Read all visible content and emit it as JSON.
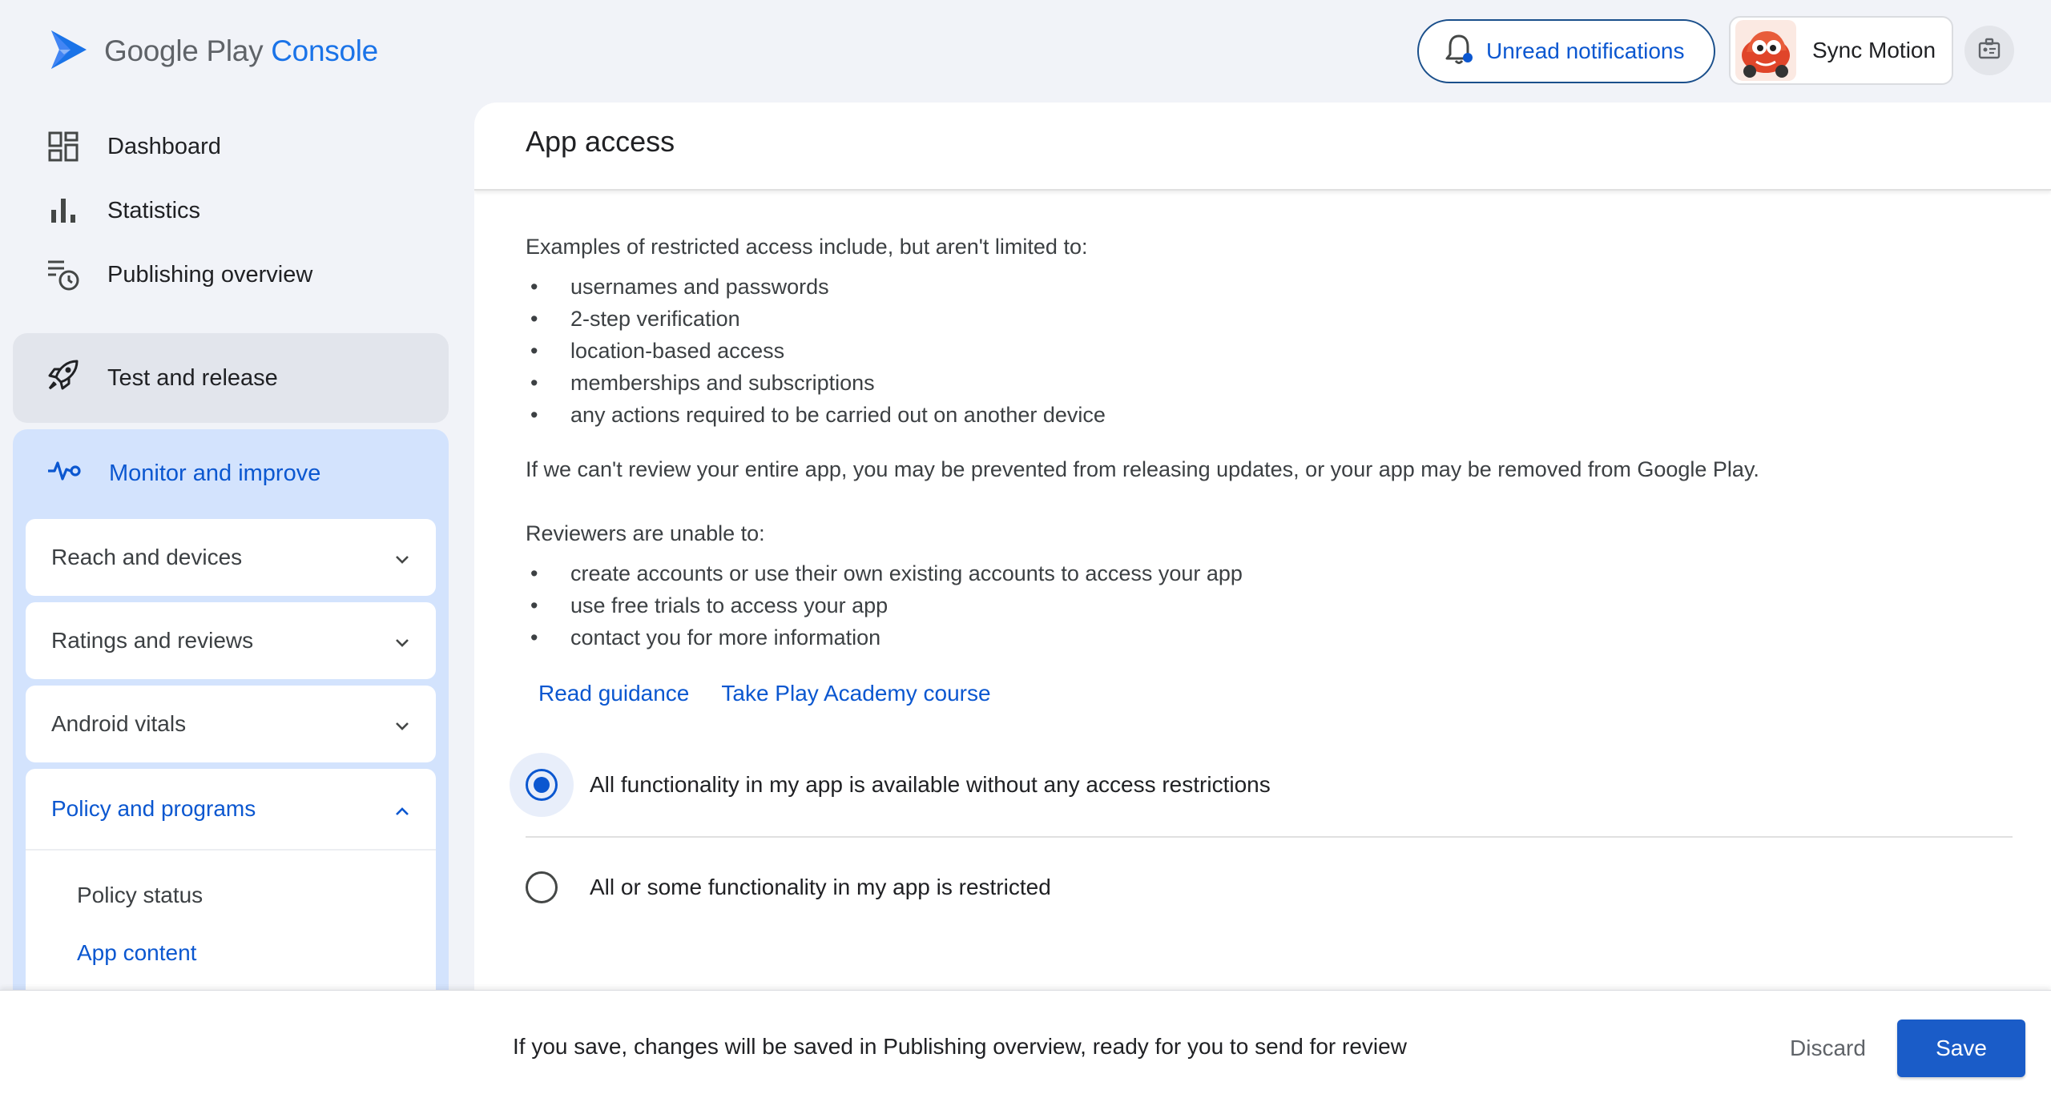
{
  "header": {
    "logo_google_play": "Google Play",
    "logo_console": "Console",
    "notifications_label": "Unread notifications",
    "account_name": "Sync Motion"
  },
  "sidebar": {
    "top_items": [
      {
        "label": "Dashboard",
        "icon": "dashboard-icon"
      },
      {
        "label": "Statistics",
        "icon": "bar-chart-icon"
      },
      {
        "label": "Publishing overview",
        "icon": "publishing-icon"
      }
    ],
    "test_release": {
      "label": "Test and release",
      "icon": "rocket-icon"
    },
    "monitor": {
      "label": "Monitor and improve",
      "icon": "pulse-icon",
      "sections": [
        {
          "label": "Reach and devices",
          "expanded": false
        },
        {
          "label": "Ratings and reviews",
          "expanded": false
        },
        {
          "label": "Android vitals",
          "expanded": false
        },
        {
          "label": "Policy and programs",
          "expanded": true
        }
      ],
      "sub_items": [
        {
          "label": "Policy status",
          "active": false
        },
        {
          "label": "App content",
          "active": true
        }
      ]
    }
  },
  "main": {
    "title": "App access",
    "restricted_intro": "Examples of restricted access include, but aren't limited to:",
    "restricted_items": [
      "usernames and passwords",
      "2-step verification",
      "location-based access",
      "memberships and subscriptions",
      "any actions required to be carried out on another device"
    ],
    "review_warning": "If we can't review your entire app, you may be prevented from releasing updates, or your app may be removed from Google Play.",
    "reviewers_intro": "Reviewers are unable to:",
    "reviewers_items": [
      "create accounts or use their own existing accounts to access your app",
      "use free trials to access your app",
      "contact you for more information"
    ],
    "links": [
      "Read guidance",
      "Take Play Academy course"
    ],
    "options": [
      {
        "label": "All functionality in my app is available without any access restrictions",
        "selected": true
      },
      {
        "label": "All or some functionality in my app is restricted",
        "selected": false
      }
    ]
  },
  "footer": {
    "message": "If you save, changes will be saved in Publishing overview, ready for you to send for review",
    "discard_label": "Discard",
    "save_label": "Save"
  },
  "colors": {
    "accent": "#0b57d0",
    "save_button": "#1a5cc8",
    "nav_selected_bg": "#d3e3fd",
    "page_bg": "#f1f3f8"
  }
}
